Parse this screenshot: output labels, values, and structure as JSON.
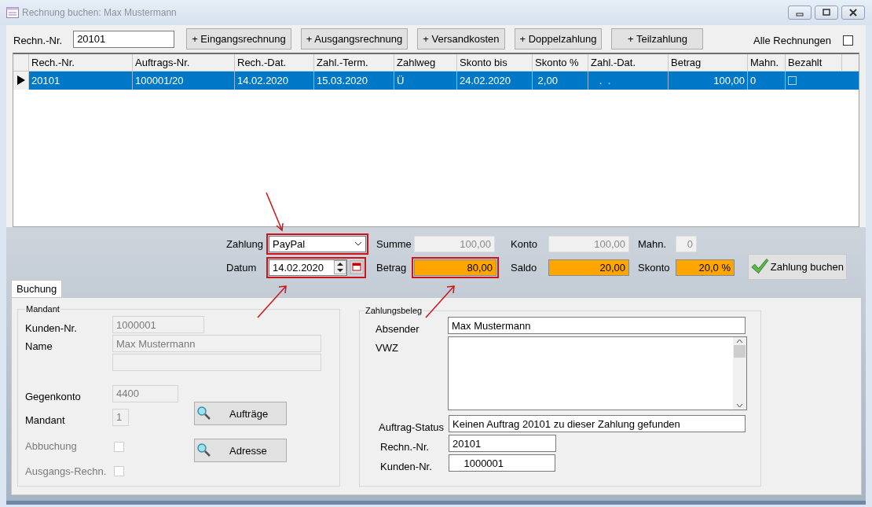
{
  "window": {
    "title": "Rechnung buchen: Max Mustermann"
  },
  "toolbar": {
    "invoice_label": "Rechn.-Nr.",
    "invoice_value": "20101",
    "buttons": [
      "+ Eingangsrechnung",
      "+ Ausgangsrechnung",
      "+ Versandkosten",
      "+ Doppelzahlung",
      "+ Teilzahlung"
    ],
    "all_invoices": {
      "label": "Alle Rechnungen",
      "checked": false
    }
  },
  "table": {
    "columns": [
      "Rech.-Nr.",
      "Auftrags-Nr.",
      "Rech.-Dat.",
      "Zahl.-Term.",
      "Zahlweg",
      "Skonto bis",
      "Skonto %",
      "Zahl.-Dat.",
      "Betrag",
      "Mahn.",
      "Bezahlt"
    ],
    "rows": [
      {
        "selected": true,
        "cells": [
          "20101",
          "100001/20",
          "14.02.2020",
          "15.03.2020",
          "Ü",
          "24.02.2020",
          " 2,00",
          "   .  .",
          "100,00",
          "0"
        ],
        "paid": false
      }
    ]
  },
  "payment": {
    "rows": [
      [
        {
          "kind": "select",
          "label": "Zahlung",
          "value": "PayPal",
          "highlighted": true,
          "arrow_above": true
        },
        {
          "kind": "readonly",
          "label": "Summe",
          "value": "100,00",
          "highlighted": false
        },
        {
          "kind": "readonly",
          "label": "Konto",
          "value": "100,00",
          "highlighted": false
        },
        {
          "kind": "readonly",
          "label": "Mahn.",
          "value": "0",
          "highlighted": false
        }
      ],
      [
        {
          "kind": "date",
          "label": "Datum",
          "value": "14.02.2020",
          "highlighted": true,
          "arrow_below": true
        },
        {
          "kind": "alert",
          "label": "Betrag",
          "value": "80,00",
          "highlighted": true,
          "arrow_below": true
        },
        {
          "kind": "alert",
          "label": "Saldo",
          "value": "20,00",
          "highlighted": false
        },
        {
          "kind": "alert",
          "label": "Skonto",
          "value": "20,0 %",
          "highlighted": false
        }
      ]
    ],
    "book_button": "Zahlung buchen"
  },
  "tabs": [
    {
      "label": "Buchung",
      "selected": true
    }
  ],
  "client": {
    "title": "Mandant",
    "customer_label": "Kunden-Nr.",
    "customer": "1000001",
    "name_label": "Name",
    "name": "Max Mustermann",
    "account_label": "Gegenkonto",
    "account": "4400",
    "client_label": "Mandant",
    "client": "1",
    "checks": [
      {
        "label": "Abbuchung",
        "checked": false,
        "disabled": true
      },
      {
        "label": "Ausgangs-Rechn.",
        "checked": false,
        "disabled": true
      }
    ],
    "buttons": [
      "Aufträge",
      "Adresse"
    ]
  },
  "receipt": {
    "title": "Zahlungsbeleg",
    "sender_label": "Absender",
    "sender": "Max Mustermann",
    "purpose_label": "VWZ",
    "status_label": "Auftrag-Status",
    "status": "Keinen Auftrag 20101 zu dieser Zahlung gefunden",
    "invoice_label": "Rechn.-Nr.",
    "invoice": "20101",
    "customer_label": "Kunden-Nr.",
    "customer": "    1000001"
  }
}
